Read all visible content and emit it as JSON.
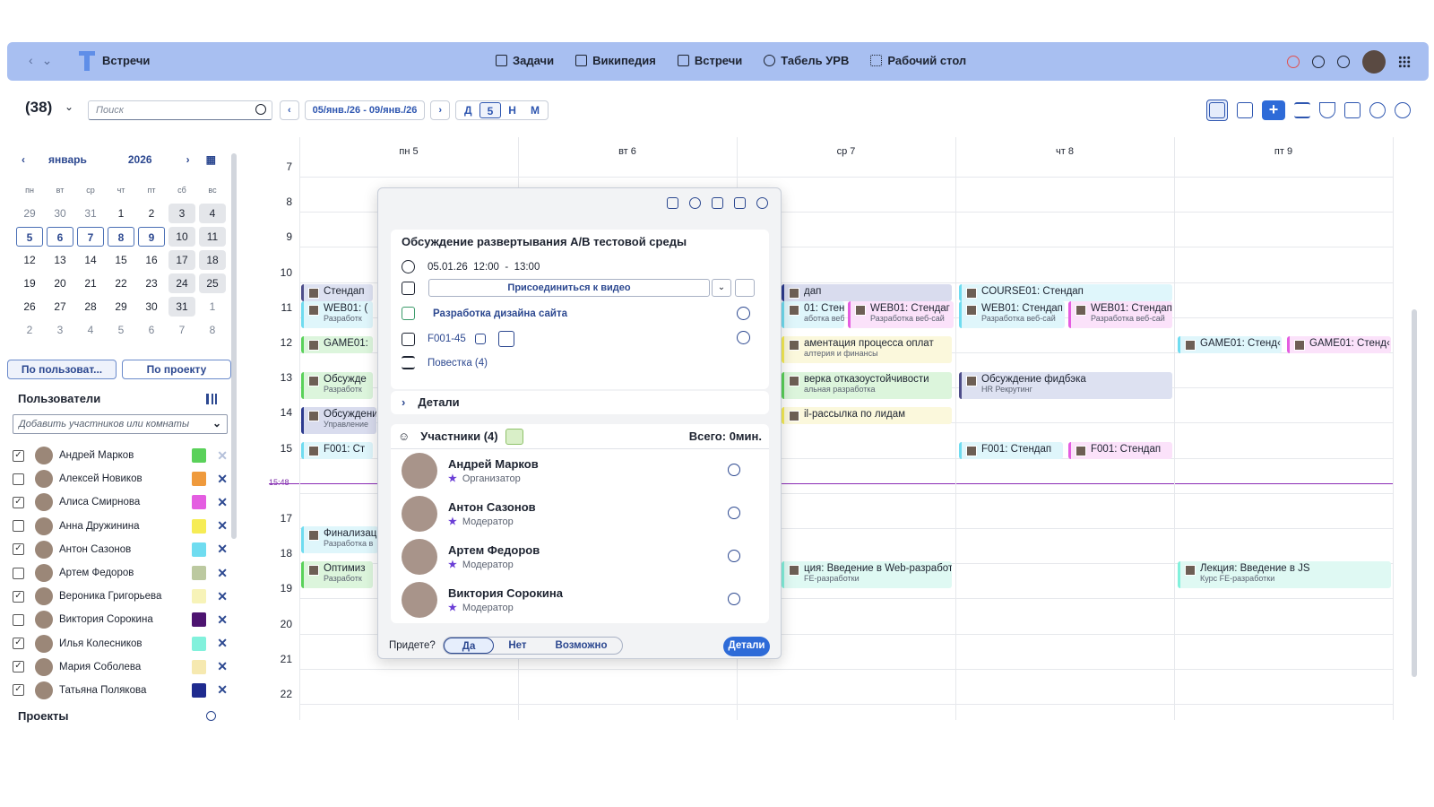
{
  "topbar": {
    "title": "Встречи",
    "menu": [
      "Задачи",
      "Википедия",
      "Встречи",
      "Табель УРВ",
      "Рабочий стол"
    ]
  },
  "toolbar": {
    "count": "(38)",
    "search_placeholder": "Поиск",
    "date_range": "05/янв./26 - 09/янв./26",
    "views": [
      "Д",
      "5",
      "Н",
      "М"
    ]
  },
  "mini_cal": {
    "month": "январь",
    "year": "2026",
    "dow": [
      "пн",
      "вт",
      "ср",
      "чт",
      "пт",
      "сб",
      "вс"
    ],
    "weeks": [
      [
        "29",
        "30",
        "31",
        "1",
        "2",
        "3",
        "4"
      ],
      [
        "5",
        "6",
        "7",
        "8",
        "9",
        "10",
        "11"
      ],
      [
        "12",
        "13",
        "14",
        "15",
        "16",
        "17",
        "18"
      ],
      [
        "19",
        "20",
        "21",
        "22",
        "23",
        "24",
        "25"
      ],
      [
        "26",
        "27",
        "28",
        "29",
        "30",
        "31",
        "1"
      ],
      [
        "2",
        "3",
        "4",
        "5",
        "6",
        "7",
        "8"
      ]
    ]
  },
  "tabs": [
    "По пользоват...",
    "По проекту"
  ],
  "users": {
    "title": "Пользователи",
    "add_placeholder": "Добавить участников или комнаты",
    "items": [
      {
        "name": "Андрей Марков",
        "checked": true,
        "color": "#5ad15a"
      },
      {
        "name": "Алексей Новиков",
        "checked": false,
        "color": "#ef9a3c"
      },
      {
        "name": "Алиса Смирнова",
        "checked": true,
        "color": "#e45de1"
      },
      {
        "name": "Анна Дружинина",
        "checked": false,
        "color": "#f6ec55"
      },
      {
        "name": "Антон Сазонов",
        "checked": true,
        "color": "#6fdcf0"
      },
      {
        "name": "Артем Федоров",
        "checked": false,
        "color": "#bcc9a0"
      },
      {
        "name": "Вероника Григорьева",
        "checked": true,
        "color": "#f7f3b8"
      },
      {
        "name": "Виктория Сорокина",
        "checked": false,
        "color": "#4d1470"
      },
      {
        "name": "Илья Колесников",
        "checked": true,
        "color": "#82f1dc"
      },
      {
        "name": "Мария Соболева",
        "checked": true,
        "color": "#f6e9b0"
      },
      {
        "name": "Татьяна Полякова",
        "checked": true,
        "color": "#1f2b8f"
      }
    ]
  },
  "projects": {
    "title": "Проекты"
  },
  "days": [
    "пн 5",
    "вт 6",
    "ср 7",
    "чт 8",
    "пт 9"
  ],
  "hours": [
    "7",
    "8",
    "9",
    "10",
    "11",
    "12",
    "13",
    "14",
    "15",
    "15:48",
    "17",
    "18",
    "19",
    "20",
    "21",
    "22"
  ],
  "events": [
    {
      "t": "Стендап",
      "s": ""
    },
    {
      "t": "WEB01: (",
      "s": "Разработк"
    },
    {
      "t": "GAME01:",
      "s": ""
    },
    {
      "t": "Обсужде",
      "s": "Разработк"
    },
    {
      "t": "Обсуждени",
      "s": "Управление"
    },
    {
      "t": "F001: Ст",
      "s": ""
    },
    {
      "t": "Финализац",
      "s": "Разработка в"
    },
    {
      "t": "Оптимиз",
      "s": "Разработк"
    },
    {
      "t": "дап",
      "s": ""
    },
    {
      "t": "01: Стендаг",
      "s": "аботка веб-сай"
    },
    {
      "t": "WEB01: Стендаг",
      "s": "Разработка веб-сай"
    },
    {
      "t": "аментация процесса оплат",
      "s": "алтерия и финансы"
    },
    {
      "t": "верка отказоустойчивости",
      "s": "альная разработка"
    },
    {
      "t": "il-рассылка по лидам",
      "s": ""
    },
    {
      "t": "ция: Введение в Web-разработку",
      "s": "FE-разработки"
    },
    {
      "t": "COURSE01: Стендап",
      "s": ""
    },
    {
      "t": "WEB01: Стендап",
      "s": "Разработка веб-сай"
    },
    {
      "t": "WEB01: Стендап",
      "s": "Разработка веб-сай"
    },
    {
      "t": "Обсуждение фидбэка",
      "s": "HR Рекрутинг"
    },
    {
      "t": "F001: Стендап",
      "s": ""
    },
    {
      "t": "F001: Стендап",
      "s": ""
    },
    {
      "t": "GAME01: Стенд‹",
      "s": ""
    },
    {
      "t": "GAME01: Стенд‹",
      "s": ""
    },
    {
      "t": "Лекция: Введение в JS",
      "s": "Курс FE-разработки"
    }
  ],
  "popup": {
    "title": "Обсуждение развертывания A/B тестовой среды",
    "date": "05.01.26",
    "start": "12:00",
    "dash": "-",
    "end": "13:00",
    "join": "Присоединиться к видео",
    "project": "Разработка дизайна сайта",
    "task": "F001-45",
    "agenda": "Повестка (4)",
    "details": "Детали",
    "participants_label": "Участники (4)",
    "total": "Всего:  0мин.",
    "participants": [
      {
        "name": "Андрей Марков",
        "role": "Организатор"
      },
      {
        "name": "Антон Сазонов",
        "role": "Модератор"
      },
      {
        "name": "Артем Федоров",
        "role": "Модератор"
      },
      {
        "name": "Виктория Сорокина",
        "role": "Модератор"
      }
    ],
    "rsvp_q": "Придете?",
    "rsvp": [
      "Да",
      "Нет",
      "Возможно"
    ],
    "details_btn": "Детали"
  }
}
